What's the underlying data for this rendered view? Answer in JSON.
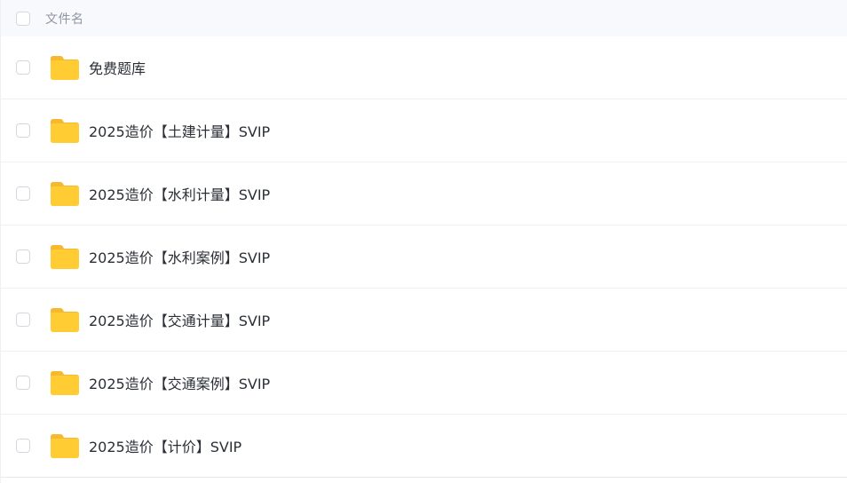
{
  "header": {
    "column_label": "文件名"
  },
  "files": [
    {
      "name": "免费题库",
      "icon": "folder-icon"
    },
    {
      "name": "2025造价【土建计量】SVIP",
      "icon": "folder-icon"
    },
    {
      "name": "2025造价【水利计量】SVIP",
      "icon": "folder-icon"
    },
    {
      "name": "2025造价【水利案例】SVIP",
      "icon": "folder-icon"
    },
    {
      "name": "2025造价【交通计量】SVIP",
      "icon": "folder-icon"
    },
    {
      "name": "2025造价【交通案例】SVIP",
      "icon": "folder-icon"
    },
    {
      "name": "2025造价【计价】SVIP",
      "icon": "folder-icon"
    }
  ],
  "colors": {
    "folder": "#FFCC33",
    "folder_tab": "#F5B82E",
    "header_bg": "#F7F9FC",
    "text": "#2B2F36"
  }
}
